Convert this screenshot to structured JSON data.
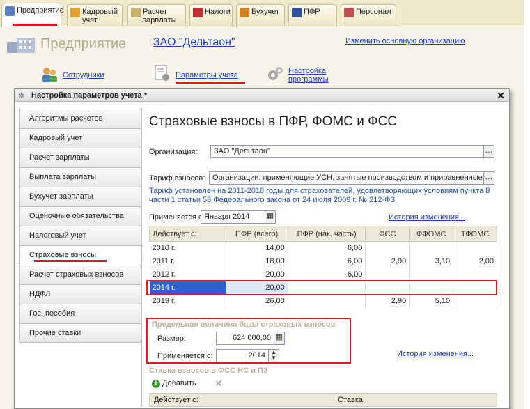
{
  "tabs": [
    {
      "label": "Предприятие",
      "active": true
    },
    {
      "label": "Кадровый учет"
    },
    {
      "label": "Расчет зарплаты"
    },
    {
      "label": "Налоги"
    },
    {
      "label": "Бухучет"
    },
    {
      "label": "ПФР"
    },
    {
      "label": "Персонал"
    }
  ],
  "page": {
    "title": "Предприятие",
    "organization": "ЗАО \"Дельтаон\"",
    "change_org": "Изменить основную организацию"
  },
  "nav": {
    "employees": "Сотрудники",
    "params": "Параметры учета",
    "settings": "Настройка программы"
  },
  "dialog": {
    "title": "Настройка параметров учета *",
    "left_nav": [
      "Алгоритмы расчетов",
      "Кадровый учет",
      "Расчет зарплаты",
      "Выплата зарплаты",
      "Бухучет зарплаты",
      "Оценочные обязательства",
      "Налоговый учет",
      "Страховые взносы",
      "Расчет страховых взносов",
      "НДФЛ",
      "Гос. пособия",
      "Прочие ставки"
    ],
    "active_nav": "Страховые взносы",
    "heading": "Страховые взносы в ПФР, ФОМС и ФСС",
    "org_label": "Организация:",
    "org_value": "ЗАО \"Дельтаон\"",
    "tariff_label": "Тариф взносов:",
    "tariff_value": "Организации, применяющие УСН, занятые производством и приравненные к ним",
    "tariff_note": "Тариф установлен на 2011-2018 годы для страхователей, удовлетворяющих условиям пункта 8 части 1 статьи 58 Федерального закона от 24 июля 2009 г. № 212-ФЗ",
    "applies_label": "Применяется с:",
    "applies_value": "Января  2014",
    "history_link": "История изменения...",
    "table": {
      "headers": [
        "Действует с:",
        "ПФР (всего)",
        "ПФР (нак. часть)",
        "ФСС",
        "ФФОМС",
        "ТФОМС"
      ],
      "rows": [
        [
          "2010 г.",
          "14,00",
          "6,00",
          "",
          "",
          ""
        ],
        [
          "2011 г.",
          "18,00",
          "6,00",
          "2,90",
          "3,10",
          "2,00"
        ],
        [
          "2012 г.",
          "20,00",
          "6,00",
          "",
          "",
          ""
        ],
        [
          "2014 г.",
          "20,00",
          "",
          "",
          "",
          ""
        ],
        [
          "2019 г.",
          "26,00",
          "",
          "2,90",
          "5,10",
          ""
        ]
      ],
      "selected_row": 3
    },
    "limit": {
      "title": "Предельная величина базы страховых взносов",
      "size_label": "Размер:",
      "size_value": "624 000,00",
      "applies_label": "Применяется с:",
      "applies_value": "2014",
      "history_link": "История изменения..."
    },
    "fss_ns": {
      "title": "Ставка взносов в ФСС НС и ПЗ",
      "add_label": "Добавить",
      "col1": "Действует с:",
      "col2": "Ставка"
    }
  },
  "colors": {
    "accent_red": "#e01820",
    "link_blue": "#1a3cc8",
    "selection": "#3060d0"
  }
}
